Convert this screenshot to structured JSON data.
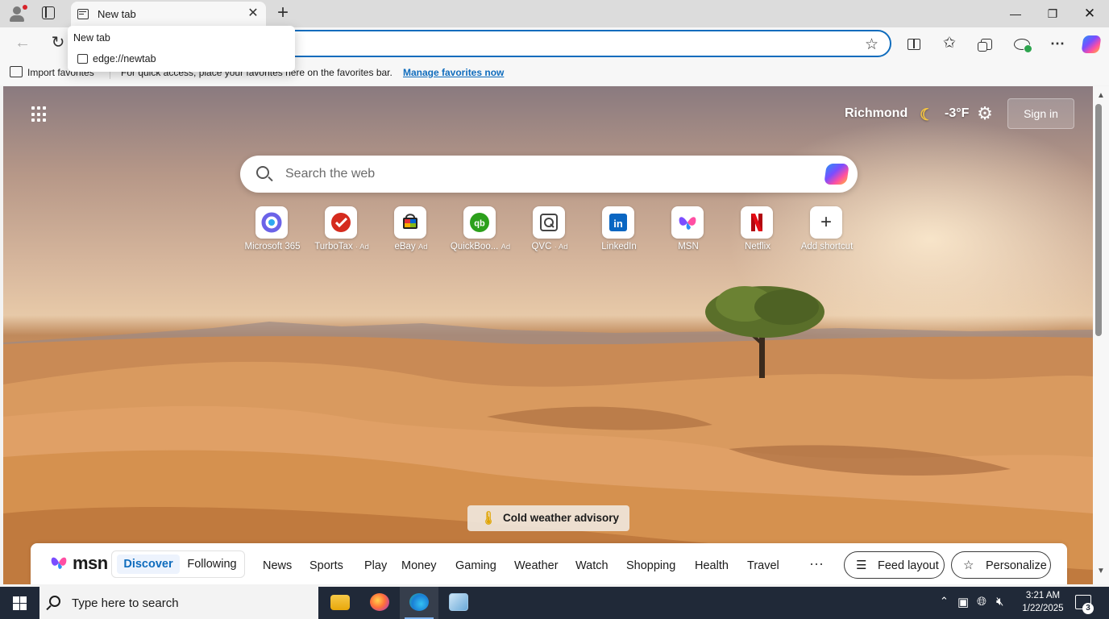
{
  "browser": {
    "tab": {
      "title": "New tab"
    },
    "dropdown": {
      "title": "New tab",
      "url": "edge://newtab"
    },
    "favorites_bar": {
      "import_label": "Import favorites",
      "hint": "For quick access, place your favorites here on the favorites bar.",
      "manage_link": "Manage favorites now"
    }
  },
  "page": {
    "weather": {
      "city": "Richmond",
      "temp": "-3°F"
    },
    "signin_label": "Sign in",
    "search": {
      "placeholder": "Search the web"
    },
    "shortcuts": [
      {
        "label": "Microsoft 365",
        "ad": ""
      },
      {
        "label": "TurboTax",
        "ad": "· Ad"
      },
      {
        "label": "eBay",
        "ad": "Ad"
      },
      {
        "label": "QuickBoo...",
        "ad": "Ad"
      },
      {
        "label": "QVC",
        "ad": "· Ad"
      },
      {
        "label": "LinkedIn",
        "ad": ""
      },
      {
        "label": "MSN",
        "ad": ""
      },
      {
        "label": "Netflix",
        "ad": ""
      },
      {
        "label": "Add shortcut",
        "ad": ""
      }
    ],
    "advisory": "Cold weather advisory",
    "msn": {
      "logo_text": "msn",
      "segment": {
        "active": "Discover",
        "inactive": "Following"
      },
      "nav": [
        "News",
        "Sports",
        "Play",
        "Money",
        "Gaming",
        "Weather",
        "Watch",
        "Shopping",
        "Health",
        "Travel"
      ],
      "more": "···",
      "feed_layout": "Feed layout",
      "personalize": "Personalize"
    }
  },
  "taskbar": {
    "search_placeholder": "Type here to search",
    "time": "3:21 AM",
    "date": "1/22/2025",
    "notifications": "3"
  },
  "colors": {
    "accent": "#0f6cbd",
    "taskbar": "#202938",
    "netflix": "#e50914",
    "linkedin": "#0a66c2",
    "quickbooks": "#2ca01c",
    "turbotax": "#d52b1e"
  }
}
